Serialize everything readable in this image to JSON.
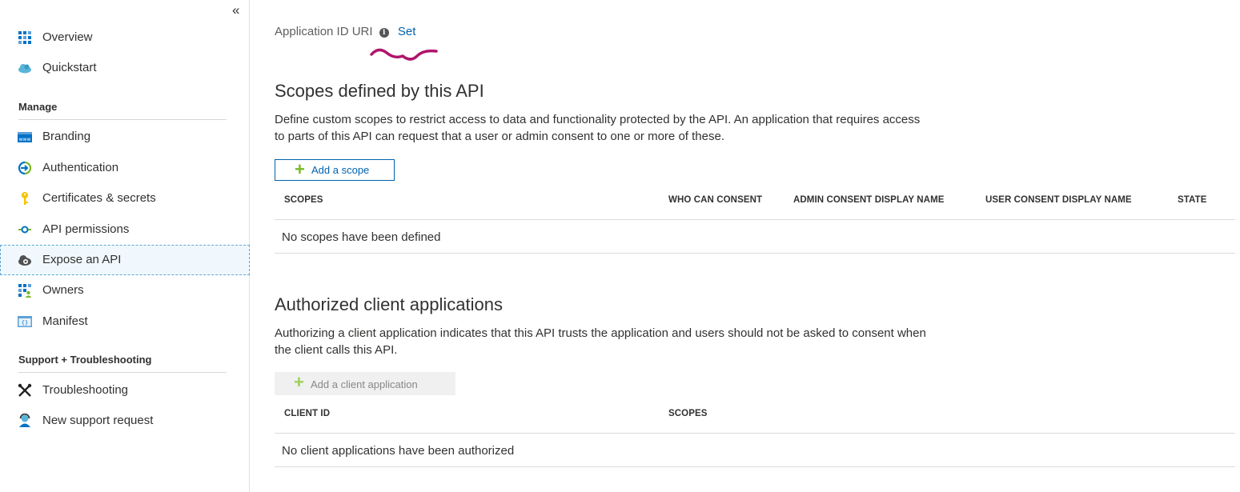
{
  "sidebar": {
    "collapse_glyph": "«",
    "items_top": [
      {
        "name": "overview",
        "label": "Overview",
        "icon": "grid-blue-icon"
      },
      {
        "name": "quickstart",
        "label": "Quickstart",
        "icon": "cloud-icon"
      }
    ],
    "manage_title": "Manage",
    "manage_items": [
      {
        "label": "Branding",
        "icon": "www-icon"
      },
      {
        "label": "Authentication",
        "icon": "authentication-icon"
      },
      {
        "label": "Certificates & secrets",
        "icon": "key-icon"
      },
      {
        "label": "API permissions",
        "icon": "api-permissions-icon"
      },
      {
        "label": "Expose an API",
        "icon": "cloud-gear-icon",
        "selected": true
      },
      {
        "label": "Owners",
        "icon": "owners-icon"
      },
      {
        "label": "Manifest",
        "icon": "manifest-icon"
      }
    ],
    "support_title": "Support + Troubleshooting",
    "support_items": [
      {
        "label": "Troubleshooting",
        "icon": "wrench-icon"
      },
      {
        "label": "New support request",
        "icon": "support-person-icon"
      }
    ]
  },
  "main": {
    "app_id_label": "Application ID URI",
    "app_id_info": "i",
    "app_id_set": "Set",
    "scopes": {
      "title": "Scopes defined by this API",
      "description": "Define custom scopes to restrict access to data and functionality protected by the API. An application that requires access to parts of this API can request that a user or admin consent to one or more of these.",
      "add_button": "Add a scope",
      "columns": [
        "SCOPES",
        "WHO CAN CONSENT",
        "ADMIN CONSENT DISPLAY NAME",
        "USER CONSENT DISPLAY NAME",
        "STATE"
      ],
      "empty_text": "No scopes have been defined"
    },
    "clients": {
      "title": "Authorized client applications",
      "description": "Authorizing a client application indicates that this API trusts the application and users should not be asked to consent when the client calls this API.",
      "add_button": "Add a client application",
      "columns": [
        "CLIENT ID",
        "SCOPES"
      ],
      "empty_text": "No client applications have been authorized"
    }
  },
  "colors": {
    "link": "#0062ad",
    "plus": "#7ab829",
    "squiggle": "#b0146a",
    "selected_bg": "#f1f8fd"
  }
}
